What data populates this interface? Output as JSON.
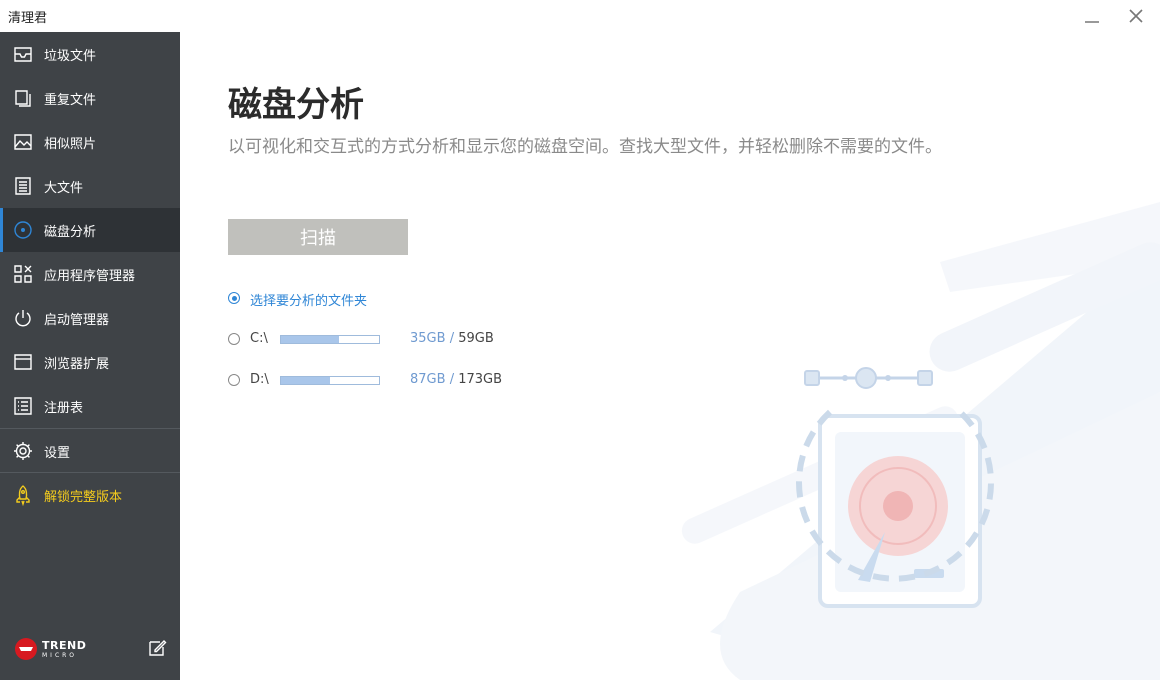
{
  "app": {
    "title": "清理君"
  },
  "window_controls": {
    "minimize_icon": "minimize-icon",
    "close_icon": "close-icon"
  },
  "sidebar": {
    "items": [
      {
        "label": "垃圾文件",
        "icon": "inbox-tray-icon",
        "active": false
      },
      {
        "label": "重复文件",
        "icon": "duplicate-icon",
        "active": false
      },
      {
        "label": "相似照片",
        "icon": "photo-icon",
        "active": false
      },
      {
        "label": "大文件",
        "icon": "document-lines-icon",
        "active": false
      },
      {
        "label": "磁盘分析",
        "icon": "disk-icon",
        "active": true
      },
      {
        "label": "应用程序管理器",
        "icon": "apps-grid-icon",
        "active": false
      },
      {
        "label": "启动管理器",
        "icon": "power-icon",
        "active": false
      },
      {
        "label": "浏览器扩展",
        "icon": "browser-window-icon",
        "active": false
      },
      {
        "label": "注册表",
        "icon": "list-icon",
        "active": false
      },
      {
        "label": "设置",
        "icon": "gear-icon",
        "active": false
      }
    ],
    "unlock": {
      "label": "解锁完整版本",
      "icon": "rocket-icon",
      "color": "#f4cc1d"
    },
    "brand": {
      "line1": "TREND",
      "line2": "MICRO"
    },
    "feedback_icon": "edit-icon"
  },
  "main": {
    "title": "磁盘分析",
    "subtitle": "以可视化和交互式的方式分析和显示您的磁盘空间。查找大型文件，并轻松删除不需要的文件。",
    "scan_button": "扫描",
    "options": {
      "folder": {
        "label": "选择要分析的文件夹",
        "selected": true
      },
      "drives": [
        {
          "label": "C:\\",
          "used": "35GB",
          "separator": "/",
          "total": "59GB",
          "fill_fraction": 0.59
        },
        {
          "label": "D:\\",
          "used": "87GB",
          "separator": "/",
          "total": "173GB",
          "fill_fraction": 0.5
        }
      ]
    }
  },
  "colors": {
    "sidebar_bg": "#3f4347",
    "accent": "#2f86d6",
    "unlock": "#f4cc1d",
    "scan_button_bg": "#c0c0bc"
  }
}
